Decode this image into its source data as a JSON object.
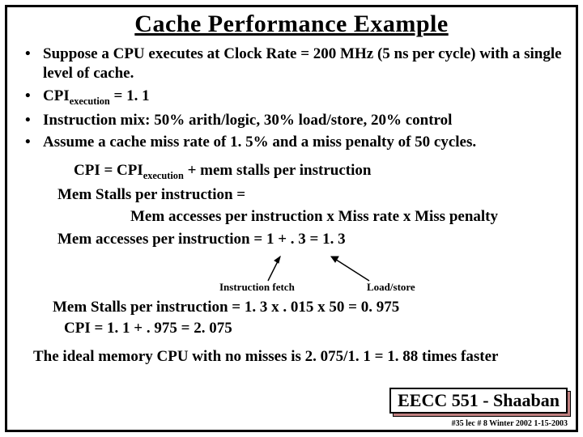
{
  "title": "Cache Performance Example",
  "bullets": {
    "b1": "Suppose a CPU executes at Clock Rate = 200 MHz (5 ns per cycle) with a single level of cache.",
    "b2a": "CPI",
    "b2sub": "execution",
    "b2b": " =  1. 1",
    "b3": "Instruction mix:   50% arith/logic,   30% load/store, 20% control",
    "b4": "Assume a cache miss rate of 1. 5% and a miss penalty of 50 cycles."
  },
  "math": {
    "line1a": "CPI =   CPI",
    "line1sub": "execution",
    "line1b": "  +   mem stalls per instruction",
    "line2": "Mem Stalls per instruction =",
    "line3": "Mem accesses per instruction  x  Miss rate x Miss penalty",
    "line4": "Mem accesses per instruction =  1  +    . 3   =  1. 3"
  },
  "arrows": {
    "ifetch": "Instruction fetch",
    "loadstore": "Load/store"
  },
  "bottom": {
    "line1": "Mem Stalls per instruction  =  1. 3 x  . 015 x 50  =   0. 975",
    "line2": "CPI =  1. 1  +  . 975 =   2. 075"
  },
  "conclusion": "The ideal memory CPU with no misses is  2. 075/1. 1 =  1. 88 times faster",
  "footer": {
    "course": "EECC 551 - Shaaban",
    "meta": "#35   lec # 8   Winter 2002  1-15-2003"
  }
}
